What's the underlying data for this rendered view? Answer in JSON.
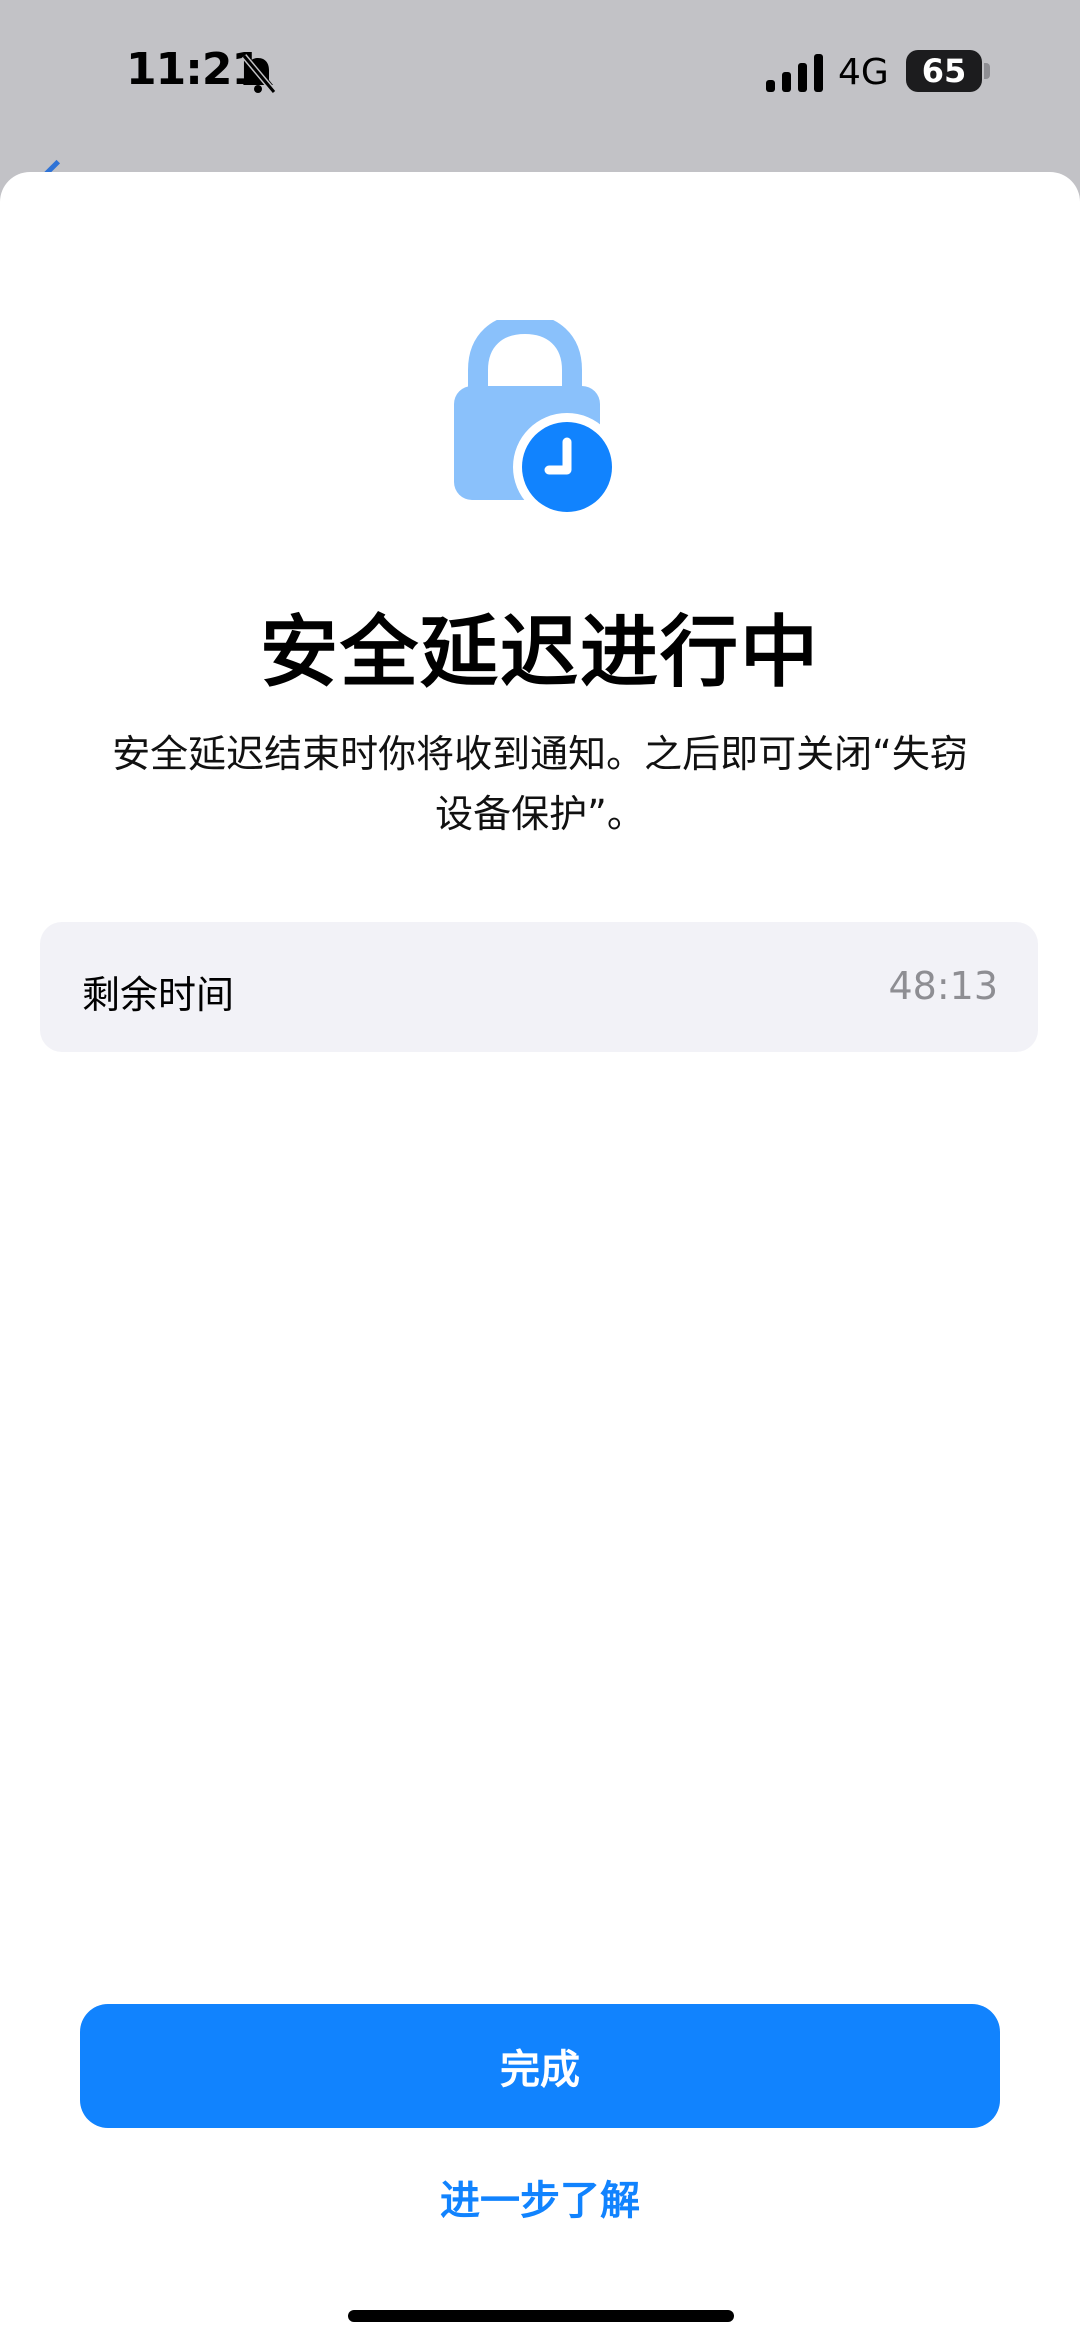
{
  "status_bar": {
    "time": "11:21",
    "network": "4G",
    "battery": "65",
    "icons": [
      "bell-slash-icon",
      "signal-icon"
    ]
  },
  "sheet": {
    "icon": "lock-clock-icon",
    "title": "安全延迟进行中",
    "description": "安全延迟结束时你将收到通知。之后即可关闭“失窃设备保护”。",
    "remaining_row": {
      "label": "剩余时间",
      "value": "48:13"
    },
    "primary_button": "完成",
    "learn_more": "进一步了解"
  },
  "colors": {
    "accent": "#1183fe",
    "lock_light": "#8ac1fb",
    "row_bg": "#f2f2f7",
    "dim_bg": "#c2c2c6"
  }
}
